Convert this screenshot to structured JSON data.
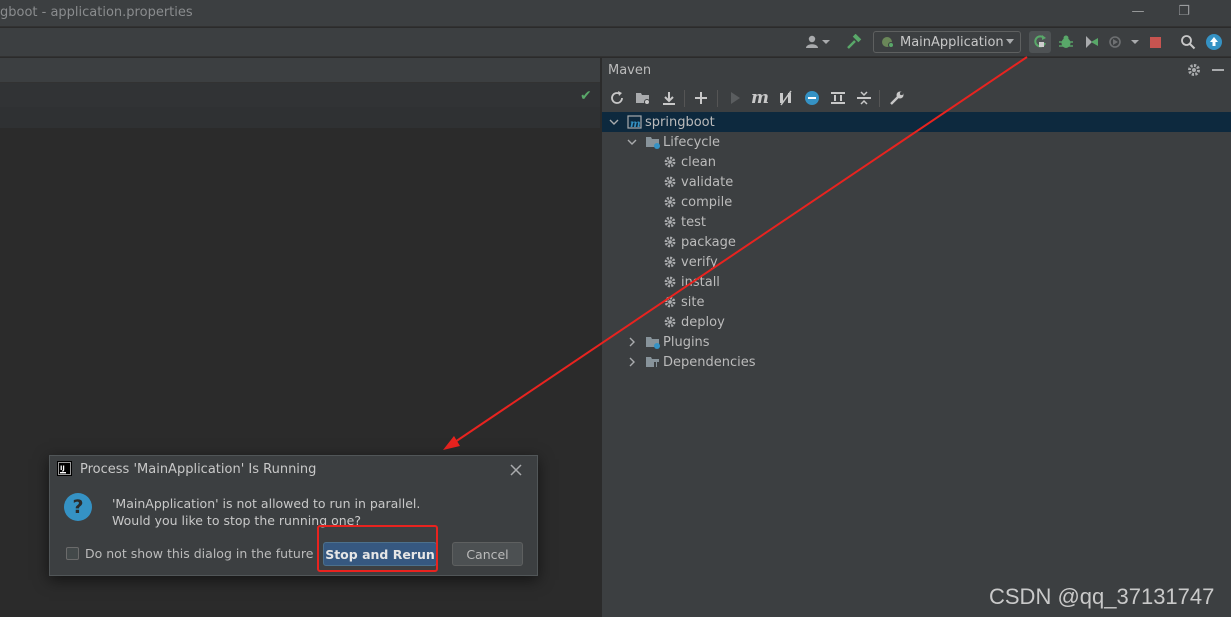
{
  "window": {
    "title": "gboot - application.properties"
  },
  "toolbar": {
    "run_config_label": "MainApplication"
  },
  "maven": {
    "panel_title": "Maven",
    "tree": {
      "project": "springboot",
      "lifecycle_label": "Lifecycle",
      "phases": [
        "clean",
        "validate",
        "compile",
        "test",
        "package",
        "verify",
        "install",
        "site",
        "deploy"
      ],
      "plugins_label": "Plugins",
      "dependencies_label": "Dependencies"
    }
  },
  "dialog": {
    "title": "Process 'MainApplication' Is Running",
    "message_line1": "'MainApplication' is not allowed to run in parallel.",
    "message_line2": "Would you like to stop the running one?",
    "checkbox_label": "Do not show this dialog in the future",
    "primary_button": "Stop and Rerun",
    "cancel_button": "Cancel"
  },
  "watermark": "CSDN @qq_37131747",
  "colors": {
    "annotation_red": "#e8231f",
    "primary_button": "#365880",
    "selection": "#0d293e"
  }
}
